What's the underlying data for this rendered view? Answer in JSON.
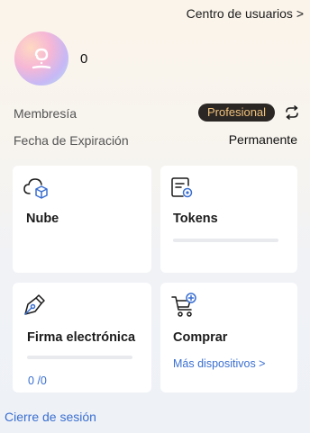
{
  "header": {
    "user_center_label": "Centro de usuarios >"
  },
  "profile": {
    "username": "0"
  },
  "membership": {
    "label": "Membresía",
    "plan_badge": "Profesional",
    "badge_bg": "#2b2725",
    "badge_text_color": "#f1c27a"
  },
  "expiry": {
    "label": "Fecha de Expiración",
    "value": "Permanente"
  },
  "cards": {
    "cloud": {
      "title": "Nube",
      "icon": "cloud-box-icon"
    },
    "tokens": {
      "title": "Tokens",
      "icon": "token-document-icon"
    },
    "esign": {
      "title": "Firma electrónica",
      "used": "0",
      "total": "/0",
      "icon": "pen-nib-icon"
    },
    "buy": {
      "title": "Comprar",
      "link": "Más dispositivos >",
      "icon": "cart-plus-icon"
    }
  },
  "footer": {
    "logout_label": "Cierre de sesión"
  },
  "colors": {
    "accent": "#3a6fd1",
    "card_bg": "#ffffff"
  }
}
